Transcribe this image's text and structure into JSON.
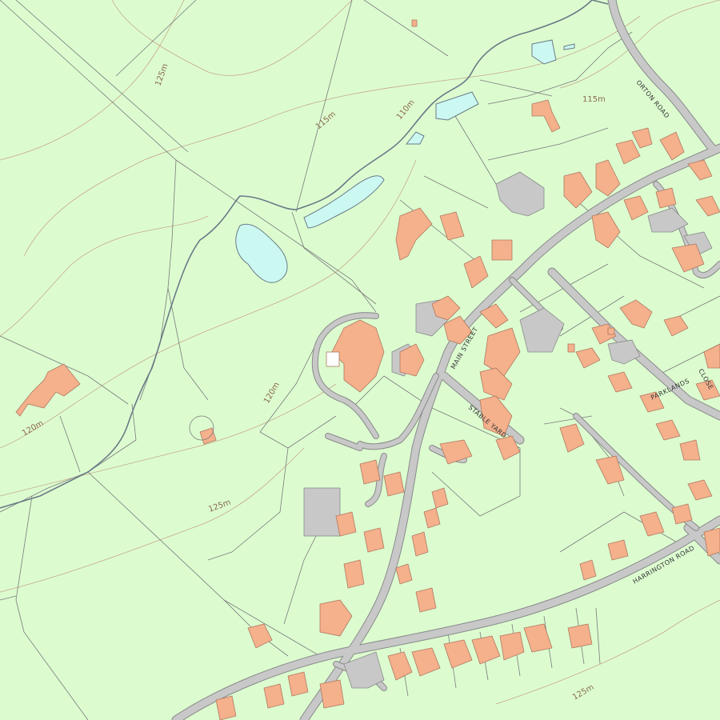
{
  "map": {
    "colors": {
      "land": "#dcfcd0",
      "building": "#f5b08c",
      "building_outline": "#b07a60",
      "road": "#c8c8c8",
      "road_edge": "#8a8a8a",
      "water": "#ccf8f2",
      "contour": "#c8a888",
      "boundary": "#7a7a7a"
    },
    "contour_labels": [
      "125m",
      "115m",
      "110m",
      "115m",
      "120m",
      "120m",
      "125m",
      "125m"
    ],
    "road_labels": [
      "ORTON ROAD",
      "MAIN STREET",
      "STABLE YARD",
      "PARKLANDS",
      "CLOSE",
      "HARRINGTON ROAD"
    ]
  }
}
